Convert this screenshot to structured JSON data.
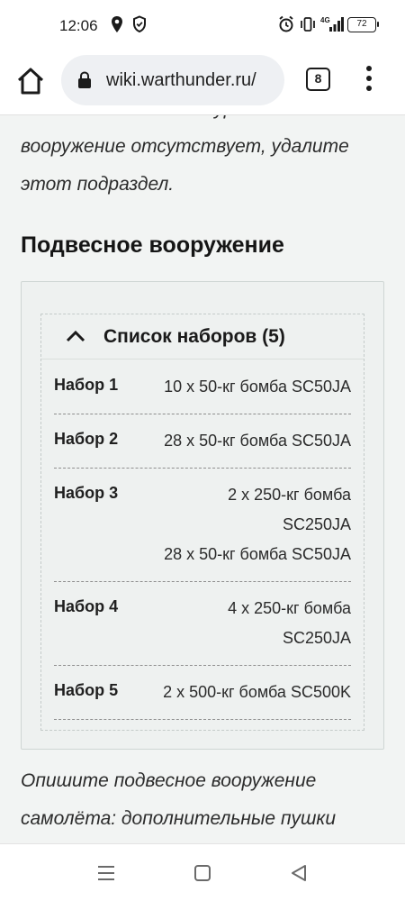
{
  "status_bar": {
    "time": "12:06",
    "battery": "72",
    "network": "4G",
    "icons": [
      "location-icon",
      "shield-icon",
      "alarm-icon",
      "vibrate-icon",
      "signal-icon",
      "battery-icon"
    ]
  },
  "browser": {
    "url": "wiki.warthunder.ru/",
    "tab_count": "8",
    "icons": [
      "home-icon",
      "lock-icon",
      "more-vert-icon"
    ]
  },
  "content": {
    "top_paragraph": "использовать. Если курсовое вооружение отсутствует, удалите этот подраздел.",
    "section_heading": "Подвесное вооружение",
    "presets": {
      "title": "Список наборов (5)",
      "items": [
        {
          "label": "Набор 1",
          "lines": [
            "10 x 50-кг бомба SC50JA"
          ]
        },
        {
          "label": "Набор 2",
          "lines": [
            "28 x 50-кг бомба SC50JA"
          ]
        },
        {
          "label": "Набор 3",
          "lines": [
            "2 x 250-кг бомба",
            "SC250JA",
            "28 x 50-кг бомба SC50JA"
          ]
        },
        {
          "label": "Набор 4",
          "lines": [
            "4 x 250-кг бомба",
            "SC250JA"
          ]
        },
        {
          "label": "Набор 5",
          "lines": [
            "2 x 500-кг бомба SC500K"
          ]
        }
      ]
    },
    "bottom_paragraph": "Опишите подвесное вооружение самолёта: дополнительные пушки"
  },
  "nav_bar": {
    "icons": [
      "recents-icon",
      "home-square-icon",
      "back-icon"
    ]
  }
}
